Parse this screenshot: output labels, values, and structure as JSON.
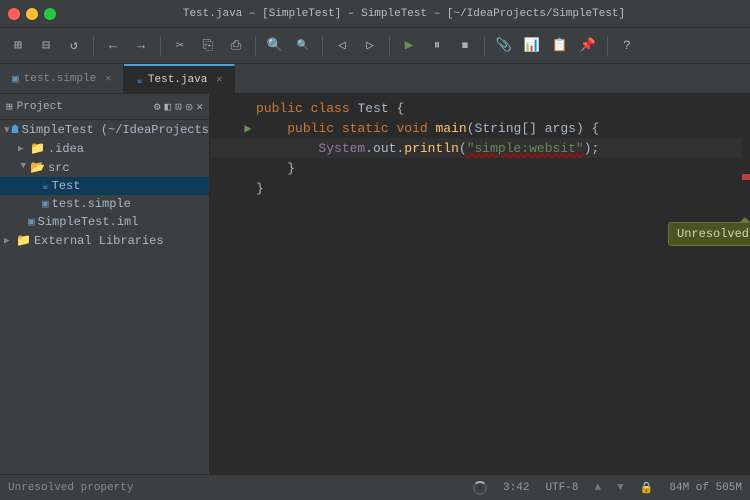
{
  "titleBar": {
    "title": "Test.java – [SimpleTest] – SimpleTest – [~/IdeaProjects/SimpleTest]"
  },
  "toolbar": {
    "buttons": [
      "⊞",
      "⊟",
      "↺",
      "←",
      "→",
      "✂",
      "⎘",
      "⎙",
      "🔍",
      "🔍+",
      "◁",
      "▷",
      "▶",
      "⏸",
      "⏹",
      "📎",
      "📊",
      "📋",
      "📌",
      "?"
    ]
  },
  "tabs": [
    {
      "label": "test.simple",
      "icon": "simple",
      "active": false
    },
    {
      "label": "Test.java",
      "icon": "java",
      "active": true
    }
  ],
  "sidebar": {
    "header": "Project",
    "tree": [
      {
        "indent": 0,
        "label": "SimpleTest (~/IdeaProjects/",
        "type": "module",
        "open": true
      },
      {
        "indent": 1,
        "label": ".idea",
        "type": "folder",
        "open": false
      },
      {
        "indent": 1,
        "label": "src",
        "type": "folder",
        "open": true
      },
      {
        "indent": 2,
        "label": "Test",
        "type": "java",
        "selected": true
      },
      {
        "indent": 2,
        "label": "test.simple",
        "type": "simple"
      },
      {
        "indent": 1,
        "label": "SimpleTest.iml",
        "type": "iml"
      },
      {
        "indent": 0,
        "label": "External Libraries",
        "type": "folder",
        "open": false
      }
    ]
  },
  "editor": {
    "filename": "Test.java",
    "lines": [
      {
        "num": "",
        "code": "public class Test {",
        "tokens": [
          {
            "t": "kw",
            "v": "public"
          },
          {
            "t": "sp",
            "v": " "
          },
          {
            "t": "kw",
            "v": "class"
          },
          {
            "t": "sp",
            "v": " "
          },
          {
            "t": "cls",
            "v": "Test"
          },
          {
            "t": "sp",
            "v": " {"
          }
        ]
      },
      {
        "num": "",
        "code": "    public static void main(String[] args) {",
        "tokens": [
          {
            "t": "sp",
            "v": "    "
          },
          {
            "t": "kw",
            "v": "public"
          },
          {
            "t": "sp",
            "v": " "
          },
          {
            "t": "kw",
            "v": "static"
          },
          {
            "t": "sp",
            "v": " "
          },
          {
            "t": "kw",
            "v": "void"
          },
          {
            "t": "sp",
            "v": " "
          },
          {
            "t": "method",
            "v": "main"
          },
          {
            "t": "sp",
            "v": "("
          },
          {
            "t": "cls",
            "v": "String"
          },
          {
            "t": "sp",
            "v": "[] args) {"
          }
        ]
      },
      {
        "num": "",
        "code": "        System.out.println(\"simple:websit\");",
        "tokens": [
          {
            "t": "sp",
            "v": "        "
          },
          {
            "t": "sys",
            "v": "System"
          },
          {
            "t": "sp",
            "v": "."
          },
          {
            "t": "txt",
            "v": "out"
          },
          {
            "t": "sp",
            "v": "."
          },
          {
            "t": "method",
            "v": "println"
          },
          {
            "t": "sp",
            "v": "("
          },
          {
            "t": "str",
            "v": "\"simple:websit\""
          },
          {
            "t": "sp",
            "v": ");"
          }
        ]
      },
      {
        "num": "",
        "code": "    }",
        "tokens": [
          {
            "t": "sp",
            "v": "    }"
          }
        ]
      },
      {
        "num": "",
        "code": "}",
        "tokens": [
          {
            "t": "sp",
            "v": "}"
          }
        ]
      }
    ]
  },
  "tooltip": {
    "text": "Unresolved property"
  },
  "statusBar": {
    "left": "Unresolved property",
    "position": "3:42",
    "encoding": "UTF-8",
    "memory": "84M of 505M"
  }
}
